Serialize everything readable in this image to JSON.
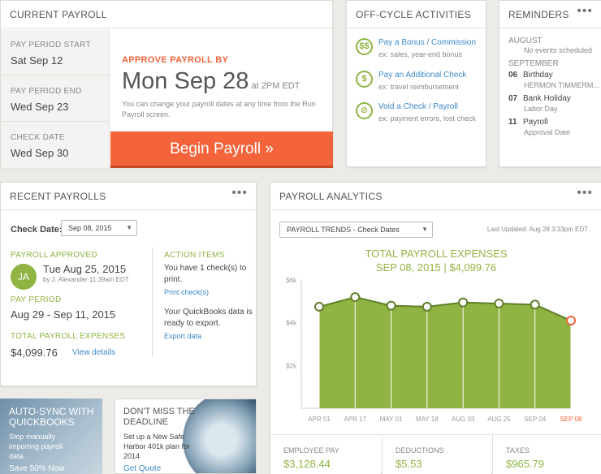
{
  "current_payroll": {
    "title": "CURRENT PAYROLL",
    "period_start_label": "PAY PERIOD START",
    "period_start": "Sat Sep 12",
    "period_end_label": "PAY PERIOD END",
    "period_end": "Wed Sep 23",
    "check_date_label": "CHECK DATE",
    "check_date": "Wed Sep 30",
    "approve_label": "APPROVE PAYROLL BY",
    "approve_date": "Mon Sep 28",
    "approve_time": " at 2PM EDT",
    "approve_note": "You can change your payroll dates at any time from the Run Payroll screen.",
    "begin_button": "Begin Payroll »"
  },
  "off_cycle": {
    "title": "OFF-CYCLE ACTIVITIES",
    "items": [
      {
        "icon": "$$",
        "title": "Pay a Bonus / Commission",
        "sub": "ex: sales, year-end bonus"
      },
      {
        "icon": "$",
        "title": "Pay an Additional Check",
        "sub": "ex: travel reimbursement"
      },
      {
        "icon": "⊘",
        "title": "Void a Check / Payroll",
        "sub": "ex: payment errors, lost check"
      }
    ]
  },
  "reminders": {
    "title": "REMINDERS",
    "menu": "•••",
    "august_label": "AUGUST",
    "august_empty": "No events scheduled",
    "september_label": "SEPTEMBER",
    "events": [
      {
        "day": "06",
        "title": "Birthday",
        "sub": "HERMON TIMMERM..."
      },
      {
        "day": "07",
        "title": "Bank Holiday",
        "sub": "Labor Day"
      },
      {
        "day": "11",
        "title": "Payroll",
        "sub": "Approval Date"
      }
    ]
  },
  "recent_payrolls": {
    "title": "RECENT PAYROLLS",
    "menu": "•••",
    "check_date_label": "Check Date:",
    "check_date_value": "Sep 08, 2015",
    "approved_label": "PAYROLL APPROVED",
    "avatar_initials": "JA",
    "approved_date": "Tue Aug 25, 2015",
    "approved_by": "by J. Alexander 11:39am EDT",
    "pay_period_label": "PAY PERIOD",
    "pay_period": "Aug 29 - Sep 11, 2015",
    "total_label": "TOTAL PAYROLL EXPENSES",
    "total_value": "$4,099.76",
    "view_details": "View details",
    "action_items_label": "ACTION ITEMS",
    "action_1_text": "You have 1 check(s) to print.",
    "action_1_link": "Print check(s)",
    "action_2_text": "Your QuickBooks data is ready to export.",
    "action_2_link": "Export data"
  },
  "analytics": {
    "title": "PAYROLL ANALYTICS",
    "menu": "•••",
    "select_value": "PAYROLL TRENDS - Check Dates",
    "last_updated": "Last Updated: Aug 28 3:33pm EDT",
    "chart_title": "TOTAL PAYROLL EXPENSES",
    "chart_subtitle": "SEP 08, 2015 | $4,099.76",
    "stats": [
      {
        "label": "EMPLOYEE PAY",
        "value": "$3,128.44"
      },
      {
        "label": "DEDUCTIONS",
        "value": "$5.53"
      },
      {
        "label": "TAXES",
        "value": "$965.79"
      }
    ]
  },
  "chart_data": {
    "type": "area",
    "title": "TOTAL PAYROLL EXPENSES",
    "categories": [
      "APR 01",
      "APR 17",
      "MAY 01",
      "MAY 18",
      "AUG 03",
      "AUG 25",
      "SEP 04",
      "SEP 08"
    ],
    "values": [
      4750,
      5200,
      4800,
      4750,
      4950,
      4900,
      4850,
      4100
    ],
    "highlight_index": 7,
    "yticks": [
      "$2k",
      "$4k",
      "$6k"
    ],
    "ytick_values": [
      2000,
      4000,
      6000
    ],
    "ylim": [
      0,
      6000
    ],
    "colors": {
      "fill": "#8fb443",
      "line": "#5f7f2a",
      "highlight": "#f0643c"
    }
  },
  "promos": {
    "p1_title": "AUTO-SYNC WITH QUICKBOOKS",
    "p1_text": "Stop manually importing payroll data.",
    "p1_cta": "Save 50% Now",
    "p2_title": "DON'T MISS THE DEADLINE",
    "p2_text": "Set up a New Safe Harbor 401k plan for 2014",
    "p2_cta": "Get Quote"
  }
}
